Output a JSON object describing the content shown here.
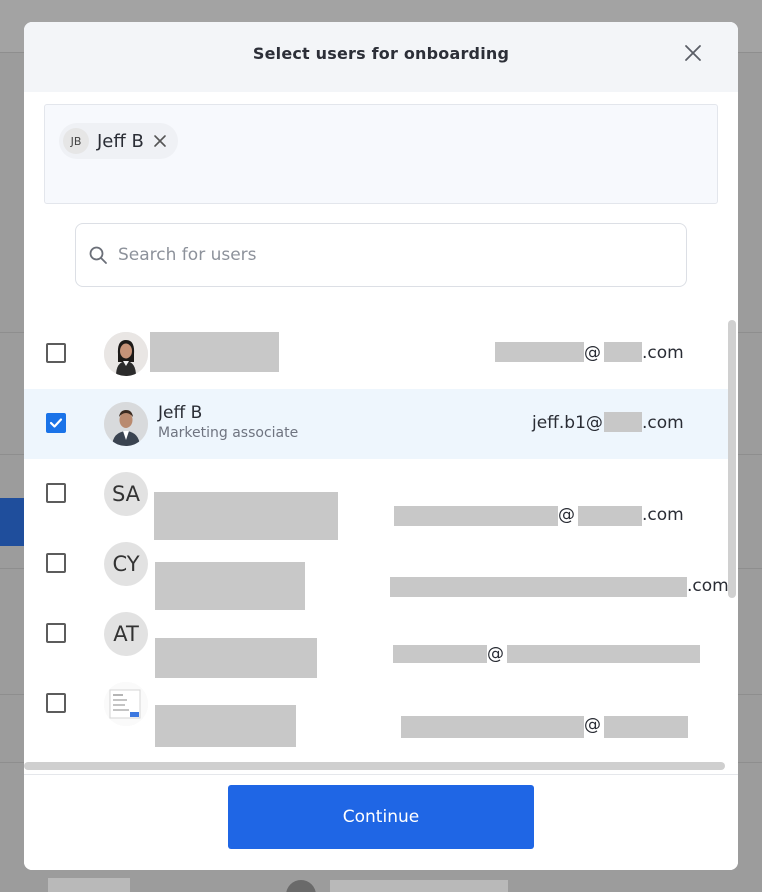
{
  "modal": {
    "title": "Select users for onboarding",
    "search_placeholder": "Search for users",
    "continue_label": "Continue"
  },
  "selected_chips": [
    {
      "initials": "JB",
      "name": "Jeff B"
    }
  ],
  "users": [
    {
      "avatar": "photo",
      "name": "",
      "role": "",
      "email_suffix": "@",
      "email_domain": ".com",
      "checked": false
    },
    {
      "avatar": "photo",
      "name": "Jeff B",
      "role": "Marketing associate",
      "email_prefix": "jeff.b1@",
      "email_domain": ".com",
      "checked": true
    },
    {
      "avatar": "SA",
      "name": "",
      "role": "",
      "email_suffix": "@",
      "email_domain": ".com",
      "checked": false
    },
    {
      "avatar": "CY",
      "name": "",
      "role": "",
      "email_domain": ".com",
      "checked": false
    },
    {
      "avatar": "AT",
      "name": "",
      "role": "",
      "email_suffix": "@",
      "checked": false
    },
    {
      "avatar": "screenshot",
      "name": "",
      "role": "",
      "email_suffix": "@",
      "checked": false
    }
  ],
  "icons": {
    "close": "close-icon",
    "search": "search-icon",
    "chip_remove": "close-icon",
    "check": "check-icon"
  },
  "colors": {
    "primary": "#1f66e5",
    "checkbox_checked": "#1a73e8",
    "selected_row": "#eef6fd"
  }
}
